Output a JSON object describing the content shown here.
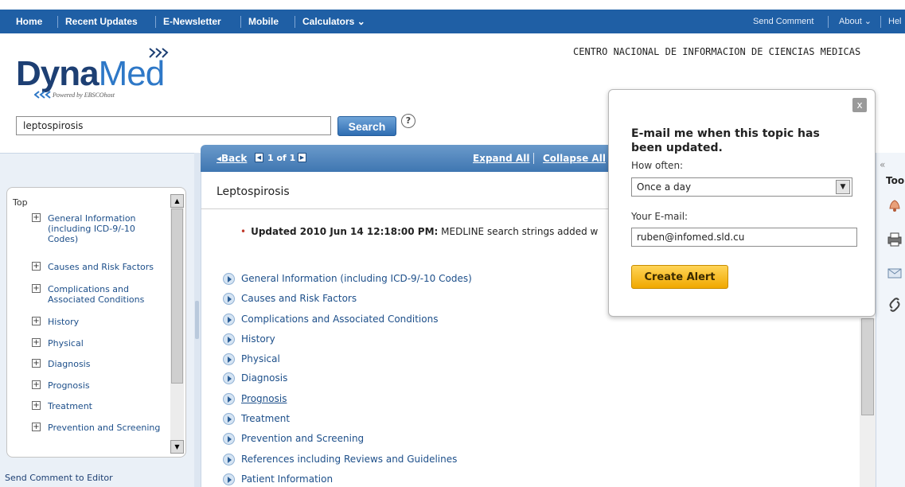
{
  "topnav": {
    "home": "Home",
    "recent_updates": "Recent Updates",
    "enewsletter": "E-Newsletter",
    "mobile": "Mobile",
    "calculators": "Calculators ⌄",
    "send_comment": "Send Comment",
    "about": "About ⌄",
    "help": "Hel"
  },
  "header": {
    "logo_dyna": "Dyna",
    "logo_med": "Med",
    "logo_tagline": "Powered by EBSCOhost",
    "organization": "CENTRO NACIONAL DE INFORMACION DE CIENCIAS MEDICAS"
  },
  "search": {
    "value": "leptospirosis",
    "button": "Search",
    "help": "?"
  },
  "toc": {
    "top": "Top",
    "items": [
      "General Information (including ICD-9/-10 Codes)",
      "Causes and Risk Factors",
      "Complications and Associated Conditions",
      "History",
      "Physical",
      "Diagnosis",
      "Prognosis",
      "Treatment",
      "Prevention and Screening"
    ],
    "send_comment": "Send Comment to Editor"
  },
  "content": {
    "back": "Back",
    "pager": "1 of 1",
    "expand_all": "Expand All",
    "collapse_all": "Collapse All",
    "title": "Leptospirosis",
    "update_bold": "Updated 2010 Jun 14 12:18:00 PM:",
    "update_rest": "MEDLINE search strings added w",
    "sections": [
      "General Information (including ICD-9/-10 Codes)",
      "Causes and Risk Factors",
      "Complications and Associated Conditions",
      "History",
      "Physical",
      "Diagnosis",
      "Prognosis",
      "Treatment",
      "Prevention and Screening",
      "References including Reviews and Guidelines",
      "Patient Information"
    ]
  },
  "tools": {
    "collapse": "«",
    "label": "Tool"
  },
  "alert": {
    "close": "x",
    "heading": "E-mail me when this topic has been updated.",
    "how_often_label": "How often:",
    "how_often_value": "Once a day",
    "email_label": "Your E-mail:",
    "email_value": "ruben@infomed.sld.cu",
    "button": "Create Alert"
  },
  "colors": {
    "nav_blue": "#1f5fa5",
    "logo_navy": "#1d3f73",
    "logo_blue": "#2e78c7",
    "link_blue": "#1d4f8a",
    "alert_button": "#f0a800"
  }
}
